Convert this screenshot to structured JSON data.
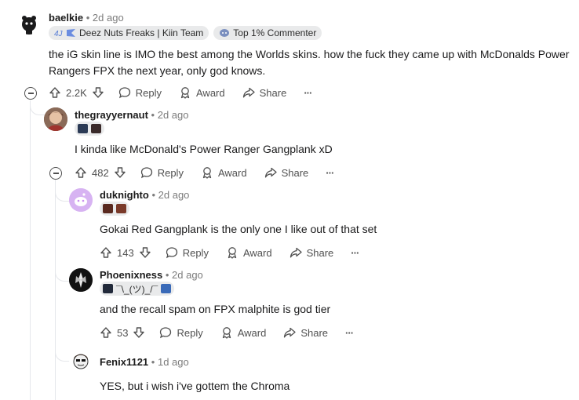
{
  "comments": [
    {
      "user": "baelkie",
      "sep": "•",
      "time": "2d ago",
      "flairs": [
        "Deez Nuts Freaks | Kiin Team",
        "Top 1% Commenter"
      ],
      "text": "the iG skin line is IMO the best among the Worlds skins. how the fuck they came up with McDonalds Power Rangers FPX the next year, only god knows.",
      "votes": "2.2K",
      "reply_label": "Reply",
      "award_label": "Award",
      "share_label": "Share",
      "more_label": "···"
    },
    {
      "user": "thegrayyernaut",
      "sep": "•",
      "time": "2d ago",
      "text": "I kinda like McDonald's Power Ranger Gangplank xD",
      "votes": "482",
      "reply_label": "Reply",
      "award_label": "Award",
      "share_label": "Share",
      "more_label": "···"
    },
    {
      "user": "duknighto",
      "sep": "•",
      "time": "2d ago",
      "text": "Gokai Red Gangplank is the only one I like out of that set",
      "votes": "143",
      "reply_label": "Reply",
      "award_label": "Award",
      "share_label": "Share",
      "more_label": "···"
    },
    {
      "user": "Phoenixness",
      "sep": "•",
      "time": "2d ago",
      "flair_text": "¯\\_(ツ)_/¯",
      "text": "and the recall spam on FPX malphite is god tier",
      "votes": "53",
      "reply_label": "Reply",
      "award_label": "Award",
      "share_label": "Share",
      "more_label": "···"
    },
    {
      "user": "Fenix1121",
      "sep": "•",
      "time": "1d ago",
      "text": "YES, but i wish i've gottem the Chroma"
    }
  ],
  "colors": {
    "thread_line": "#e5e7eb",
    "text": "#1a1a1b",
    "muted": "#7c7c7c",
    "flair_bg": "#e9eaeb"
  }
}
